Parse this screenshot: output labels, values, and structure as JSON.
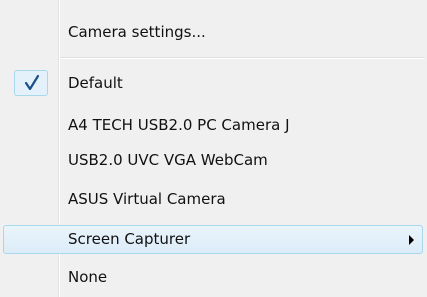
{
  "menu": {
    "items": [
      {
        "label": "Camera settings..."
      },
      {
        "label": "Default",
        "checked": true
      },
      {
        "label": "A4 TECH USB2.0 PC Camera J"
      },
      {
        "label": "USB2.0 UVC VGA WebCam"
      },
      {
        "label": "ASUS Virtual Camera"
      },
      {
        "label": "Screen Capturer",
        "has_submenu": true,
        "highlighted": true
      },
      {
        "label": "None"
      }
    ],
    "check_icon": "checkmark-icon",
    "submenu_icon": "submenu-arrow-icon",
    "colors": {
      "background": "#f0f0f0",
      "highlight_border": "#a8d8eb",
      "check_color": "#1a4f8a"
    }
  }
}
